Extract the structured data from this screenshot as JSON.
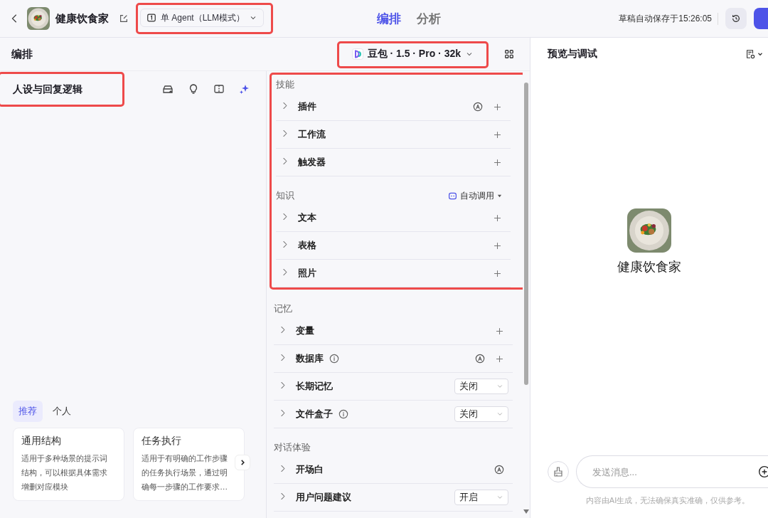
{
  "top_bar": {
    "bot_name": "健康饮食家",
    "mode_selector": {
      "label": "单 Agent（LLM模式）",
      "highlighted": true
    },
    "tabs": [
      {
        "label": "编排",
        "selected": true
      },
      {
        "label": "分析",
        "selected": false
      }
    ],
    "save_status": "草稿自动保存于15:26:05"
  },
  "editor": {
    "title": "编排",
    "model_selector": {
      "label": "豆包 · 1.5 · Pro · 32k",
      "highlighted": true
    }
  },
  "persona": {
    "title": "人设与回复逻辑",
    "highlighted": true
  },
  "prompt_templates": {
    "tabs": [
      {
        "label": "推荐",
        "selected": true
      },
      {
        "label": "个人",
        "selected": false
      }
    ],
    "cards": [
      {
        "title": "通用结构",
        "description": "适用于多种场景的提示词结构，可以根据具体需求增删对应模块"
      },
      {
        "title": "任务执行",
        "description": "适用于有明确的工作步骤的任务执行场景，通过明确每一步骤的工作要求…"
      }
    ]
  },
  "sections": [
    {
      "title": "技能",
      "highlighted": true,
      "items": [
        {
          "label": "插件",
          "kind": "actions",
          "info": false,
          "auto": true,
          "add": true
        },
        {
          "label": "工作流",
          "kind": "actions",
          "info": false,
          "auto": false,
          "add": true
        },
        {
          "label": "触发器",
          "kind": "actions",
          "info": false,
          "auto": false,
          "add": true
        }
      ]
    },
    {
      "title": "知识",
      "highlighted": true,
      "mode": "自动调用",
      "items": [
        {
          "label": "文本",
          "kind": "actions",
          "info": false,
          "auto": false,
          "add": true
        },
        {
          "label": "表格",
          "kind": "actions",
          "info": false,
          "auto": false,
          "add": true
        },
        {
          "label": "照片",
          "kind": "actions",
          "info": false,
          "auto": false,
          "add": true
        }
      ]
    },
    {
      "title": "记忆",
      "highlighted": false,
      "items": [
        {
          "label": "变量",
          "kind": "actions",
          "info": false,
          "auto": false,
          "add": true
        },
        {
          "label": "数据库",
          "kind": "actions",
          "info": true,
          "auto": true,
          "add": true
        },
        {
          "label": "长期记忆",
          "kind": "select",
          "info": false,
          "value": "关闭"
        },
        {
          "label": "文件盒子",
          "kind": "select",
          "info": true,
          "value": "关闭"
        }
      ]
    },
    {
      "title": "对话体验",
      "highlighted": false,
      "items": [
        {
          "label": "开场白",
          "kind": "actions",
          "info": false,
          "auto": true,
          "add": false
        },
        {
          "label": "用户问题建议",
          "kind": "select",
          "info": false,
          "value": "开启"
        }
      ]
    }
  ],
  "preview": {
    "title": "预览与调试",
    "bot_name": "健康饮食家",
    "input": {
      "placeholder": "发送消息..."
    },
    "disclaimer": "内容由AI生成，无法确保真实准确，仅供参考。"
  }
}
